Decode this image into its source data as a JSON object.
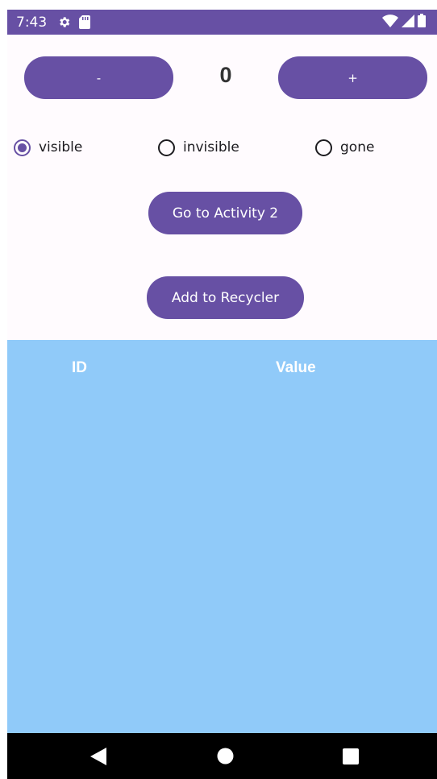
{
  "status_bar": {
    "time": "7:43",
    "icons": [
      "gear-icon",
      "sd-card-icon",
      "wifi-icon",
      "signal-icon",
      "battery-icon"
    ],
    "background": "#6750A4"
  },
  "counter": {
    "minus_label": "-",
    "value": "0",
    "plus_label": "+"
  },
  "visibility_options": {
    "selected": "visible",
    "items": [
      {
        "label": "visible",
        "checked": true
      },
      {
        "label": "invisible",
        "checked": false
      },
      {
        "label": "gone",
        "checked": false
      }
    ]
  },
  "buttons": {
    "go_to_activity_2": "Go to Activity 2",
    "add_to_recycler": "Add to Recycler"
  },
  "recycler": {
    "background": "#90CAF9",
    "columns": [
      "ID",
      "Value"
    ],
    "rows": []
  },
  "nav_bar": {
    "icons": [
      "back-icon",
      "home-icon",
      "recents-icon"
    ]
  },
  "colors": {
    "primary": "#6750A4",
    "surface": "#FFFBFE",
    "list_bg": "#90CAF9"
  }
}
